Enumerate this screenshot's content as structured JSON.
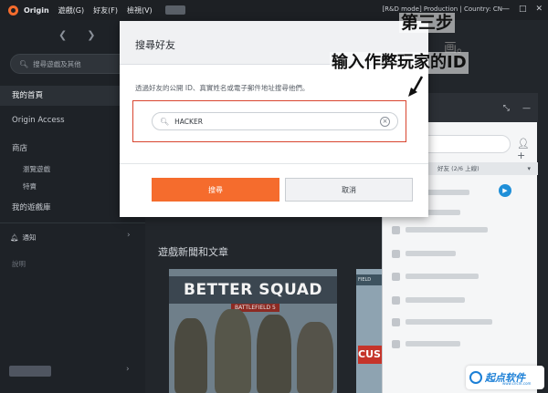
{
  "titlebar": {
    "app_name": "Origin",
    "menus": [
      "遊戲(G)",
      "好友(F)",
      "檢視(V)"
    ],
    "status": "[R&D mode] Production | Country: CN",
    "controls": [
      "—",
      "□",
      "✕"
    ]
  },
  "sidebar": {
    "search_placeholder": "搜尋遊戲及其他",
    "home": "我的首頁",
    "origin_access": "Origin Access",
    "store": "商店",
    "browse_games": "瀏覽遊戲",
    "deals": "特賣",
    "library": "我的遊戲庫",
    "notifications": "通知",
    "help": "說明"
  },
  "main": {
    "news_title": "遊戲新聞和文章",
    "card1_title": "BETTER SQUAD",
    "card1_sub": "BATTLEFIELD 5",
    "card2_tag": "CUS",
    "card2_stripe": "FIELD"
  },
  "friends_panel": {
    "group_label": "好友 (2/6 上線)"
  },
  "modal": {
    "title": "搜尋好友",
    "description": "透過好友的公開 ID、真實姓名或電子郵件地址搜尋他們。",
    "input_value": "HACKER",
    "search_button": "搜尋",
    "cancel_button": "取消"
  },
  "annotation": {
    "step": "第三步",
    "note": "输入作弊玩家的ID",
    "bg_text": "画。"
  },
  "watermark": {
    "name": "起点软件",
    "sub": "www.cncrk.com"
  },
  "colors": {
    "accent": "#f56c2d",
    "sidebar_bg": "#1e2227",
    "highlight": "#d9452f"
  }
}
